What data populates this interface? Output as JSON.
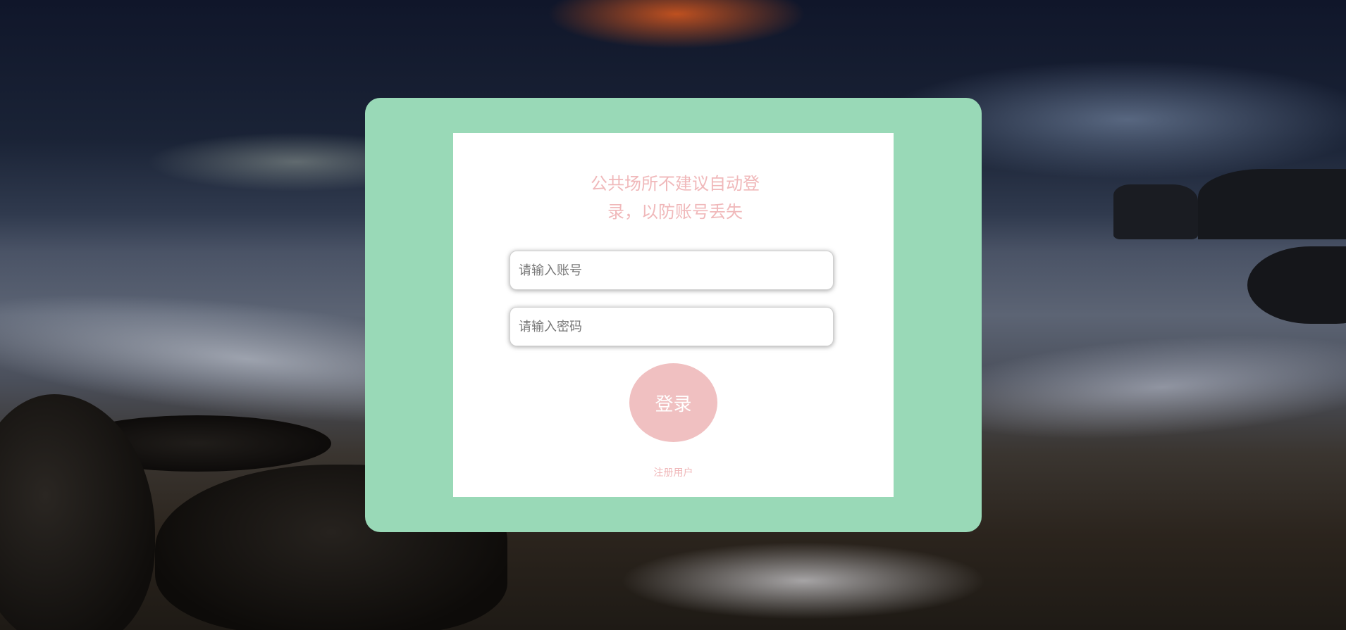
{
  "background": {
    "description_icon": "seascape-background-image"
  },
  "login": {
    "notice": "公共场所不建议自动登录，以防账号丢失",
    "account_placeholder": "请输入账号",
    "password_placeholder": "请输入密码",
    "login_label": "登录",
    "register_label": "注册用户"
  },
  "colors": {
    "card": "#99d9b7",
    "panel": "#ffffff",
    "accent_pink": "#f0c0c1",
    "notice_text": "#f0b8ba"
  }
}
